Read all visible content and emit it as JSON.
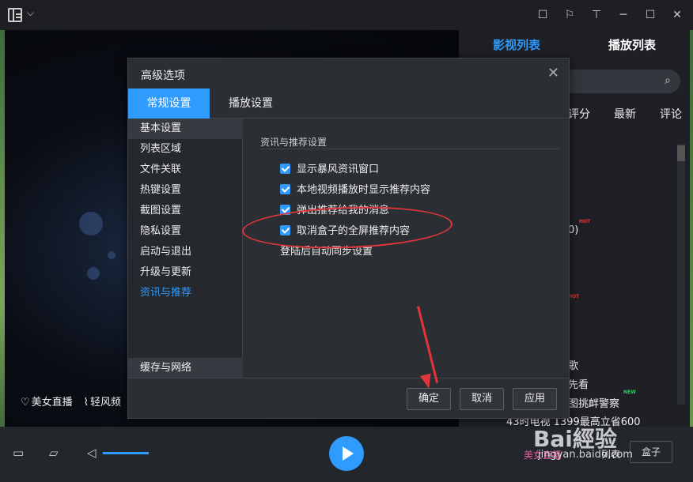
{
  "colors": {
    "accent": "#2f9bff",
    "annotation": "#e0353a"
  },
  "titlebar": {
    "icons": [
      "menu-logo-icon",
      "chevron-down-icon",
      "message-icon",
      "skin-icon",
      "shirt-icon",
      "minimize-icon",
      "maximize-icon",
      "close-icon"
    ],
    "chevron": "⌵",
    "win_icons": [
      "☐",
      "⚐",
      "⊤",
      "─",
      "☐",
      "✕"
    ]
  },
  "video": {
    "links": [
      {
        "icon": "♡",
        "label": "美女直播"
      },
      {
        "icon": "⌇",
        "label": "轻风频"
      }
    ]
  },
  "right_panel": {
    "tabs": [
      "影视列表",
      "播放列表"
    ],
    "search_icon": "⌕",
    "categories": [
      "评分",
      "最新",
      "评论"
    ],
    "partial_lines": [
      "0)",
      "歌",
      "先看",
      "图挑衅警察",
      "43时电视 1399最高立省600"
    ],
    "hot_tag": "HOT",
    "new_tag": "NEW"
  },
  "modal": {
    "title": "高级选项",
    "close": "✕",
    "tabs": [
      "常规设置",
      "播放设置"
    ],
    "sidebar": [
      "基本设置",
      "列表区域",
      "文件关联",
      "热键设置",
      "截图设置",
      "隐私设置",
      "启动与退出",
      "升级与更新",
      "资讯与推荐"
    ],
    "sidebar_bottom": "缓存与网络",
    "section_title": "资讯与推荐设置",
    "options": [
      {
        "label": "显示暴风资讯窗口",
        "checked": true
      },
      {
        "label": "本地视频播放时显示推荐内容",
        "checked": true
      },
      {
        "label": "弹出推荐给我的消息",
        "checked": true
      },
      {
        "label": "取消盒子的全屏推荐内容",
        "checked": true
      }
    ],
    "sync_label": "登陆后自动同步设置",
    "buttons": {
      "ok": "确定",
      "cancel": "取消",
      "apply": "应用"
    }
  },
  "bottombar": {
    "link_live": "美女直播",
    "link_left": "列表",
    "box_label": "盒子"
  },
  "watermark": {
    "brand": "Bai經验",
    "url": "jingyan.baidu.com"
  }
}
